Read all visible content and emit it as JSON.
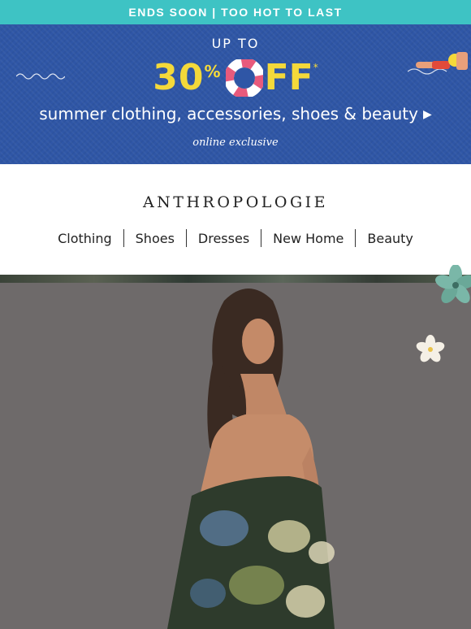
{
  "topbar": {
    "text": "ENDS SOON | TOO HOT TO LAST"
  },
  "promo": {
    "up_to": "UP TO",
    "discount_number": "30",
    "discount_percent": "%",
    "discount_off": "FF",
    "asterisk": "*",
    "subline": "summer clothing, accessories, shoes & beauty",
    "arrow": "▶",
    "exclusive": "online exclusive",
    "colors": {
      "bg": "#2f56a6",
      "accent": "#f4d93a",
      "ring_red": "#e85a7c"
    }
  },
  "brand": {
    "logo": "ANTHROPOLOGIE",
    "nav": [
      {
        "label": "Clothing"
      },
      {
        "label": "Shoes"
      },
      {
        "label": "Dresses"
      },
      {
        "label": "New Home"
      },
      {
        "label": "Beauty"
      }
    ]
  },
  "hero": {
    "image": "model in strapless floral dress",
    "icons": [
      "teal-flower-icon",
      "white-flower-icon"
    ]
  }
}
